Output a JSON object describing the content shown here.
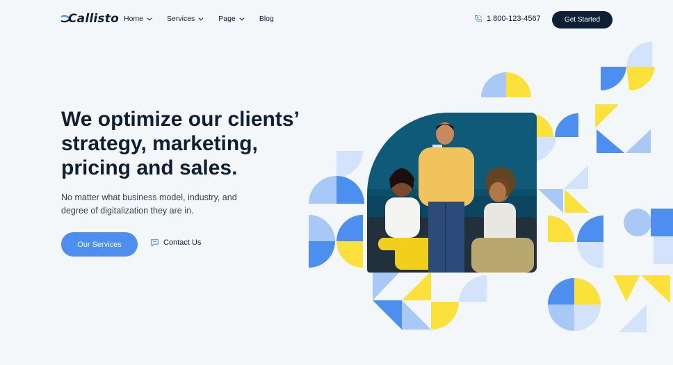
{
  "brand": {
    "name": "Callisto"
  },
  "nav": {
    "items": [
      {
        "label": "Home",
        "has_dropdown": true
      },
      {
        "label": "Services",
        "has_dropdown": true
      },
      {
        "label": "Page",
        "has_dropdown": true
      },
      {
        "label": "Blog",
        "has_dropdown": false
      }
    ],
    "phone": "1 800-123-4567",
    "cta_label": "Get Started"
  },
  "hero": {
    "headline_lines": [
      "We optimize our clients’",
      "strategy, marketing,",
      "pricing and sales."
    ],
    "subtext": "No matter what business model, industry, and degree of digitalization they are in.",
    "primary_button": "Our Services",
    "secondary_button": "Contact Us"
  },
  "colors": {
    "navy": "#0e2036",
    "blue": "#4d8ff1",
    "light_blue": "#a8c8f8",
    "pale_blue": "#d3e3fb",
    "yellow": "#fbe13a",
    "teal_wall": "#0d4e6a",
    "background": "#f3f7fa"
  },
  "icons": {
    "phone": "phone-icon",
    "contact": "chat-bubble-icon",
    "logo_mark": "logo-swoosh-icon"
  }
}
